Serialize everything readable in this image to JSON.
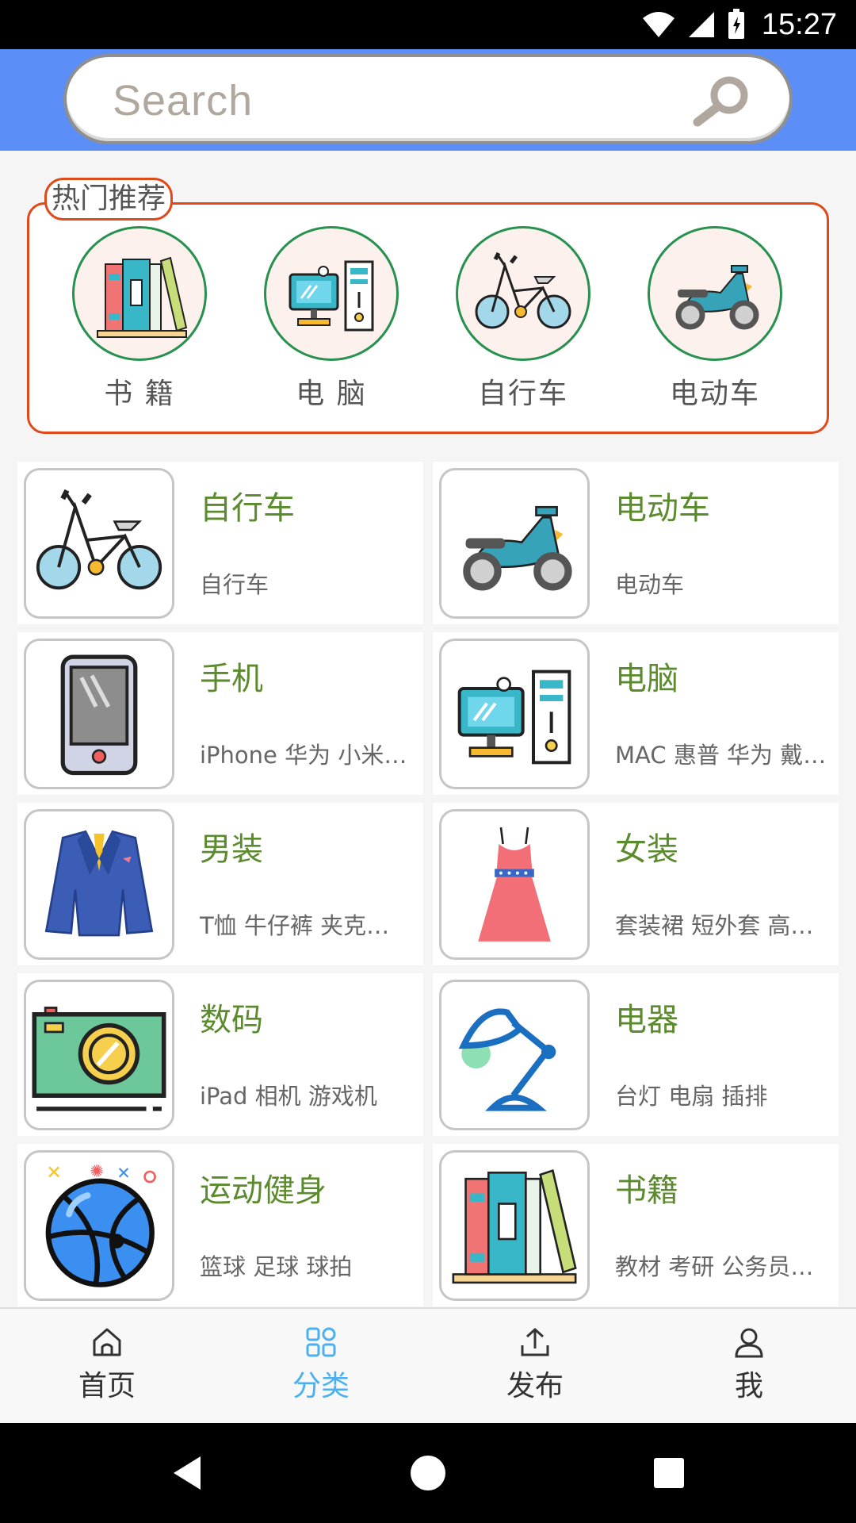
{
  "status_bar": {
    "time": "15:27"
  },
  "search": {
    "placeholder": "Search"
  },
  "hot": {
    "title": "热门推荐",
    "items": [
      {
        "label": "书 籍",
        "icon": "books-icon"
      },
      {
        "label": "电 脑",
        "icon": "computer-icon"
      },
      {
        "label": "自行车",
        "icon": "bicycle-icon"
      },
      {
        "label": "电动车",
        "icon": "scooter-icon"
      }
    ]
  },
  "categories": [
    {
      "title": "自行车",
      "subtitle": "自行车",
      "icon": "bicycle-icon"
    },
    {
      "title": "电动车",
      "subtitle": "电动车",
      "icon": "scooter-icon"
    },
    {
      "title": "手机",
      "subtitle": "iPhone 华为 小米…",
      "icon": "phone-icon"
    },
    {
      "title": "电脑",
      "subtitle": "MAC 惠普 华为 戴…",
      "icon": "computer-icon"
    },
    {
      "title": "男装",
      "subtitle": "T恤 牛仔裤 夹克…",
      "icon": "suit-icon"
    },
    {
      "title": "女装",
      "subtitle": "套装裙 短外套 高…",
      "icon": "dress-icon"
    },
    {
      "title": "数码",
      "subtitle": "iPad 相机 游戏机",
      "icon": "camera-icon"
    },
    {
      "title": "电器",
      "subtitle": "台灯 电扇 插排",
      "icon": "lamp-icon"
    },
    {
      "title": "运动健身",
      "subtitle": "篮球 足球 球拍",
      "icon": "ball-icon"
    },
    {
      "title": "书籍",
      "subtitle": "教材 考研 公务员…",
      "icon": "books-icon"
    }
  ],
  "nav": {
    "home": "首页",
    "category": "分类",
    "publish": "发布",
    "me": "我",
    "active": "category",
    "active_color": "#4ab0ef"
  },
  "colors": {
    "header": "#5b8ef7",
    "accent_title": "#5c8a2e",
    "hot_border": "#e04a1b"
  }
}
